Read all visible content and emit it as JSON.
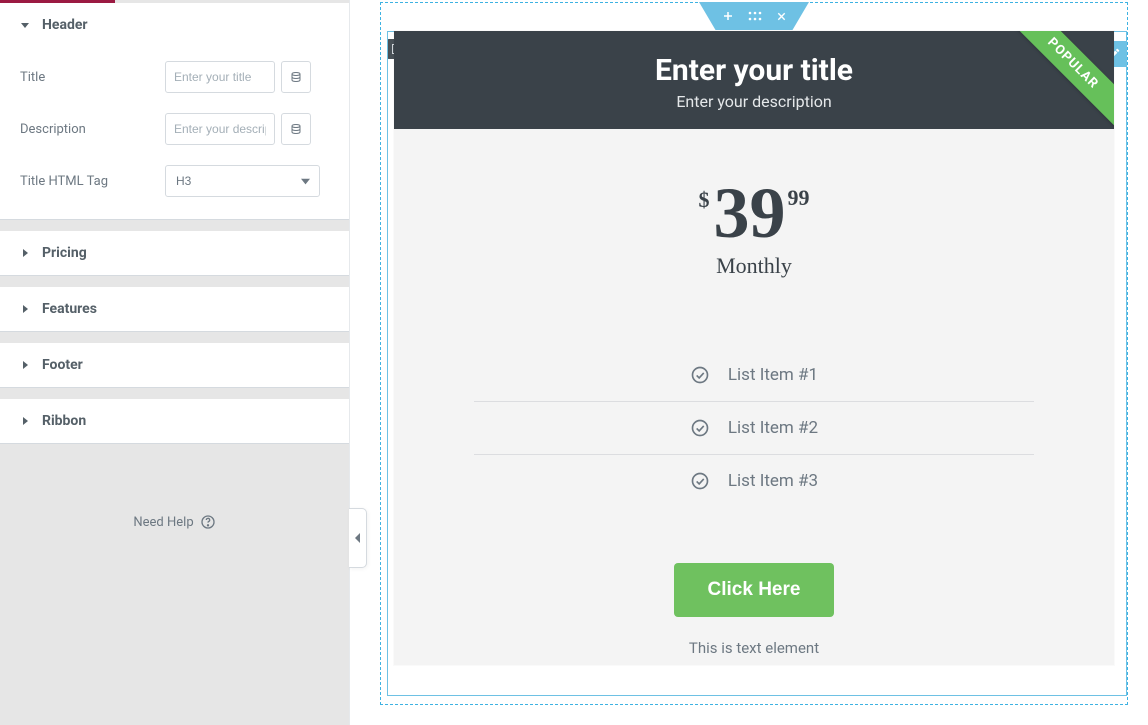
{
  "sidebar": {
    "sections": {
      "header": "Header",
      "pricing": "Pricing",
      "features": "Features",
      "footer": "Footer",
      "ribbon": "Ribbon"
    },
    "controls": {
      "title_label": "Title",
      "title_placeholder": "Enter your title",
      "description_label": "Description",
      "description_placeholder": "Enter your description",
      "html_tag_label": "Title HTML Tag",
      "html_tag_value": "H3"
    },
    "help": "Need Help"
  },
  "card": {
    "title": "Enter your title",
    "description": "Enter your description",
    "ribbon": "POPULAR",
    "currency": "$",
    "amount": "39",
    "cents": "99",
    "period": "Monthly",
    "features": [
      "List Item #1",
      "List Item #2",
      "List Item #3"
    ],
    "cta": "Click Here",
    "footer_text": "This is text element"
  }
}
